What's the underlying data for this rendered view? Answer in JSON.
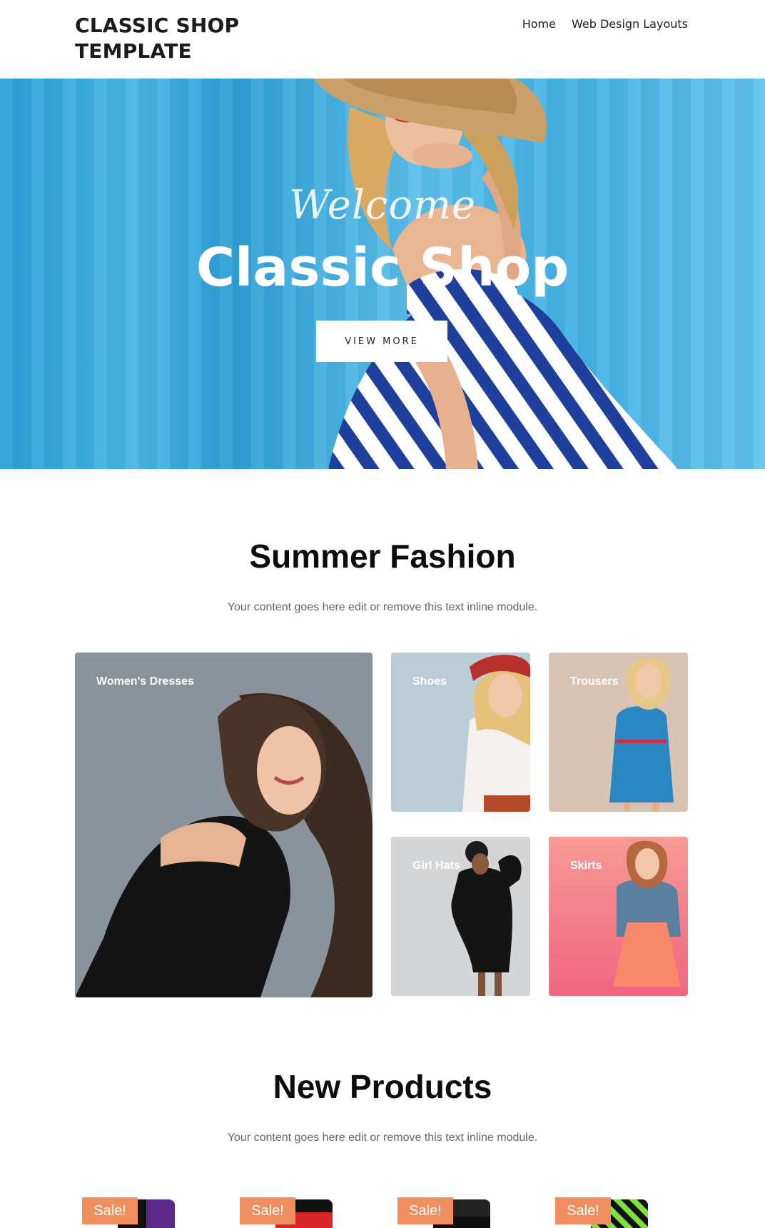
{
  "header": {
    "logo": "CLASSIC SHOP TEMPLATE",
    "nav": [
      "Home",
      "Web Design Layouts"
    ]
  },
  "hero": {
    "welcome": "Welcome",
    "title": "Classic Shop",
    "button": "VIEW MORE"
  },
  "summer": {
    "title": "Summer Fashion",
    "subtitle": "Your content goes here edit or remove this text inline module.",
    "categories": [
      "Women's Dresses",
      "Shoes",
      "Trousers",
      "Girl Hats",
      "Skirts"
    ]
  },
  "products": {
    "title": "New Products",
    "subtitle": "Your content goes here edit or remove this text inline module.",
    "badges": [
      "Sale!",
      "Sale!",
      "Sale!",
      "Sale!"
    ]
  },
  "colors": {
    "accent": "#ef8f5f",
    "hero_blue": "#3aa9de"
  }
}
